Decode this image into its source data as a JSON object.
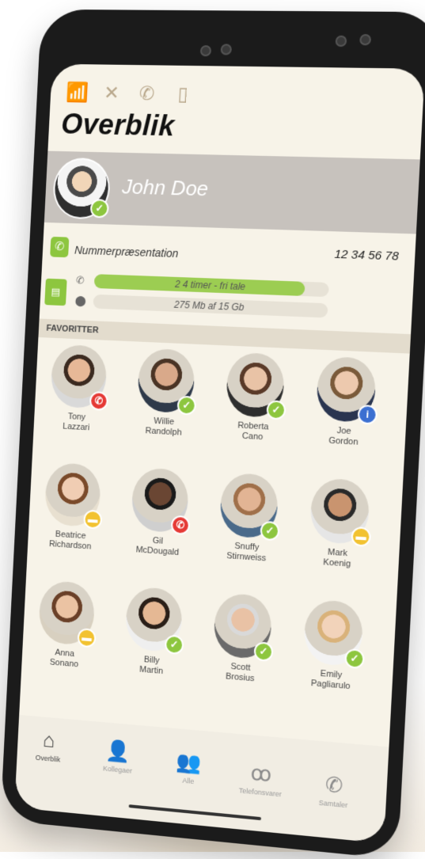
{
  "status_icons": [
    "signal-icon",
    "no-forward-icon",
    "call-settings-icon",
    "no-mobile-icon"
  ],
  "title": "Overblik",
  "user": {
    "name": "John Doe",
    "status": "ok"
  },
  "number_presentation": {
    "label": "Nummerpræsentation",
    "value": "12 34 56 78"
  },
  "usage": {
    "talk": {
      "label": "2 4 timer - fri tale",
      "fill": 0.9
    },
    "data": {
      "label": "275 Mb af 15 Gb",
      "fill": 0.02
    }
  },
  "favorites_header": "FAVORITTER",
  "favorites": [
    {
      "first": "Tony",
      "last": "Lazzari",
      "status": "busy",
      "skin": "#e7b897",
      "hair": "#3b2a20",
      "shirt": "#d9d9d9"
    },
    {
      "first": "Willie",
      "last": "Randolph",
      "status": "ok",
      "skin": "#d9a98a",
      "hair": "#4a3425",
      "shirt": "#2f3a4a"
    },
    {
      "first": "Roberta",
      "last": "Cano",
      "status": "ok",
      "skin": "#e9c3a6",
      "hair": "#5a3a28",
      "shirt": "#2e2e2e"
    },
    {
      "first": "Joe",
      "last": "Gordon",
      "status": "info",
      "skin": "#edc9ae",
      "hair": "#7a5a3a",
      "shirt": "#2a3550"
    },
    {
      "first": "Beatrice",
      "last": "Richardson",
      "status": "away",
      "skin": "#f0cdb3",
      "hair": "#7a4a2a",
      "shirt": "#e8e0d0"
    },
    {
      "first": "Gil",
      "last": "McDougald",
      "status": "busy",
      "skin": "#6a4633",
      "hair": "#1a1a1a",
      "shirt": "#cfcfcf"
    },
    {
      "first": "Snuffy",
      "last": "Stirnweiss",
      "status": "ok",
      "skin": "#e2b494",
      "hair": "#a0704a",
      "shirt": "#4a6a8a"
    },
    {
      "first": "Mark",
      "last": "Koenig",
      "status": "away",
      "skin": "#c9946f",
      "hair": "#2a2a2a",
      "shirt": "#e6e6e6"
    },
    {
      "first": "Anna",
      "last": "Sonano",
      "status": "away",
      "skin": "#ebc3a3",
      "hair": "#6a4028",
      "shirt": "#d8d0c0"
    },
    {
      "first": "Billy",
      "last": "Martin",
      "status": "ok",
      "skin": "#e5b894",
      "hair": "#2a1f18",
      "shirt": "#efefef"
    },
    {
      "first": "Scott",
      "last": "Brosius",
      "status": "ok",
      "skin": "#e9c2a5",
      "hair": "#d9d9d9",
      "shirt": "#6a6a6a"
    },
    {
      "first": "Emily",
      "last": "Pagliarulo",
      "status": "ok",
      "skin": "#f2d3ba",
      "hair": "#d9b27a",
      "shirt": "#f3f3f3"
    }
  ],
  "tabs": [
    {
      "label": "Overblik",
      "icon": "home-icon",
      "active": true
    },
    {
      "label": "Kollegaer",
      "icon": "person-icon",
      "active": false
    },
    {
      "label": "Alle",
      "icon": "group-icon",
      "active": false
    },
    {
      "label": "Telefonsvarer",
      "icon": "voicemail-icon",
      "active": false
    },
    {
      "label": "Samtaler",
      "icon": "phone-icon",
      "active": false
    }
  ],
  "colors": {
    "accent": "#8dc63f",
    "busy": "#e53935",
    "away": "#f2c230",
    "info": "#3b6fd1"
  }
}
